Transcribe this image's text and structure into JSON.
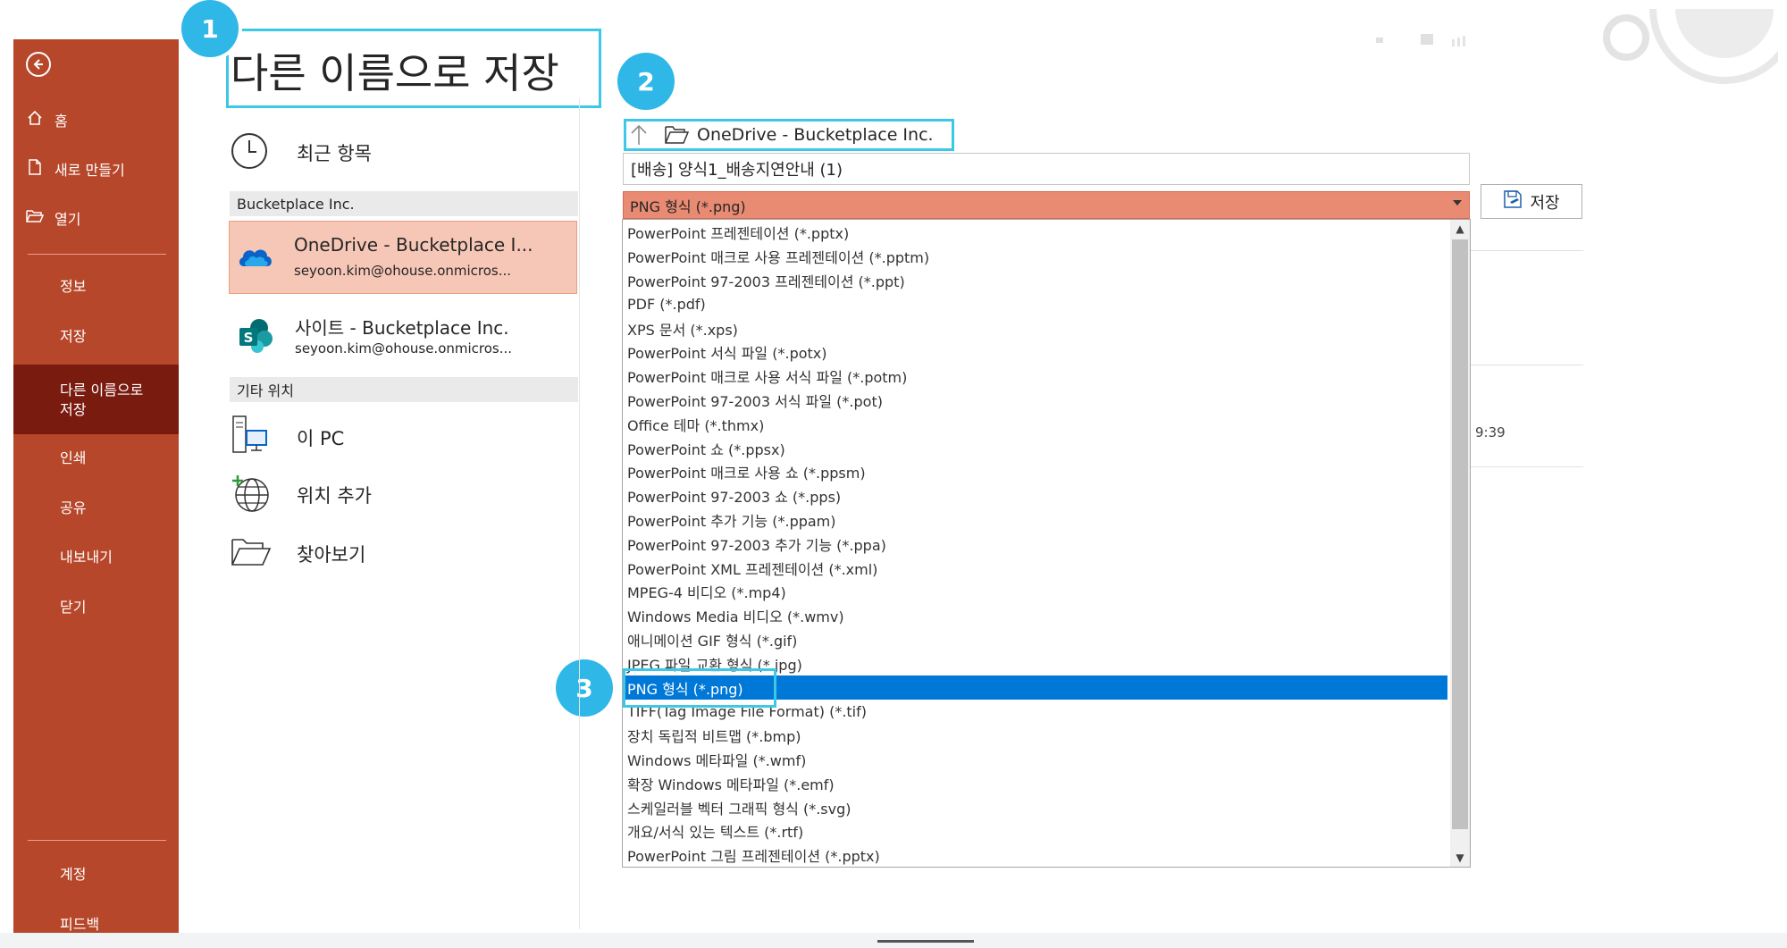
{
  "sidebar": {
    "back_label": "⬅",
    "items": [
      {
        "label": "홈",
        "icon": "home-icon"
      },
      {
        "label": "새로 만들기",
        "icon": "new-document-icon"
      },
      {
        "label": "열기",
        "icon": "open-folder-icon"
      }
    ],
    "sub_items": [
      "정보",
      "저장",
      "다른 이름으로\n저장",
      "인쇄",
      "공유",
      "내보내기",
      "닫기"
    ],
    "bottom_items": [
      "계정",
      "피드백"
    ]
  },
  "title": "다른 이름으로 저장",
  "callouts": [
    "1",
    "2",
    "3"
  ],
  "locations": {
    "recent": "최근 항목",
    "org_header": "Bucketplace Inc.",
    "onedrive": {
      "name": "OneDrive - Bucketplace I...",
      "email": "seyoon.kim@ohouse.onmicros..."
    },
    "site": {
      "name": "사이트 - Bucketplace Inc.",
      "email": "seyoon.kim@ohouse.onmicros..."
    },
    "other_header": "기타 위치",
    "this_pc": "이 PC",
    "add_place": "위치 추가",
    "browse": "찾아보기"
  },
  "path": {
    "text": "OneDrive - Bucketplace Inc."
  },
  "filename": "[배송] 양식1_배송지연안내 (1)",
  "file_type": "PNG 형식 (*.png)",
  "save_button": "저장",
  "time_text": "9:39",
  "file_types": [
    "PowerPoint 프레젠테이션 (*.pptx)",
    "PowerPoint 매크로 사용 프레젠테이션 (*.pptm)",
    "PowerPoint 97-2003 프레젠테이션 (*.ppt)",
    "PDF (*.pdf)",
    "XPS 문서 (*.xps)",
    "PowerPoint 서식 파일 (*.potx)",
    "PowerPoint 매크로 사용 서식 파일 (*.potm)",
    "PowerPoint 97-2003 서식 파일 (*.pot)",
    "Office 테마 (*.thmx)",
    "PowerPoint 쇼 (*.ppsx)",
    "PowerPoint 매크로 사용 쇼 (*.ppsm)",
    "PowerPoint 97-2003 쇼 (*.pps)",
    "PowerPoint 추가 기능 (*.ppam)",
    "PowerPoint 97-2003 추가 기능 (*.ppa)",
    "PowerPoint XML 프레젠테이션 (*.xml)",
    "MPEG-4 비디오 (*.mp4)",
    "Windows Media 비디오 (*.wmv)",
    "애니메이션 GIF 형식 (*.gif)",
    "JPEG 파일 교환 형식 (*.jpg)",
    "PNG 형식 (*.png)",
    "TIFF(Tag Image File Format) (*.tif)",
    "장치 독립적 비트맵 (*.bmp)",
    "Windows 메타파일 (*.wmf)",
    "확장 Windows 메타파일 (*.emf)",
    "스케일러블 벡터 그래픽 형식 (*.svg)",
    "개요/서식 있는 텍스트 (*.rtf)",
    "PowerPoint 그림 프레젠테이션 (*.pptx)"
  ],
  "selected_index": 19,
  "colors": {
    "sidebar": "#b7472a",
    "sidebar_active": "#7a1b10",
    "callout": "#2fb7e8",
    "selection": "#0078d7",
    "accent_fill": "#e98a73"
  }
}
